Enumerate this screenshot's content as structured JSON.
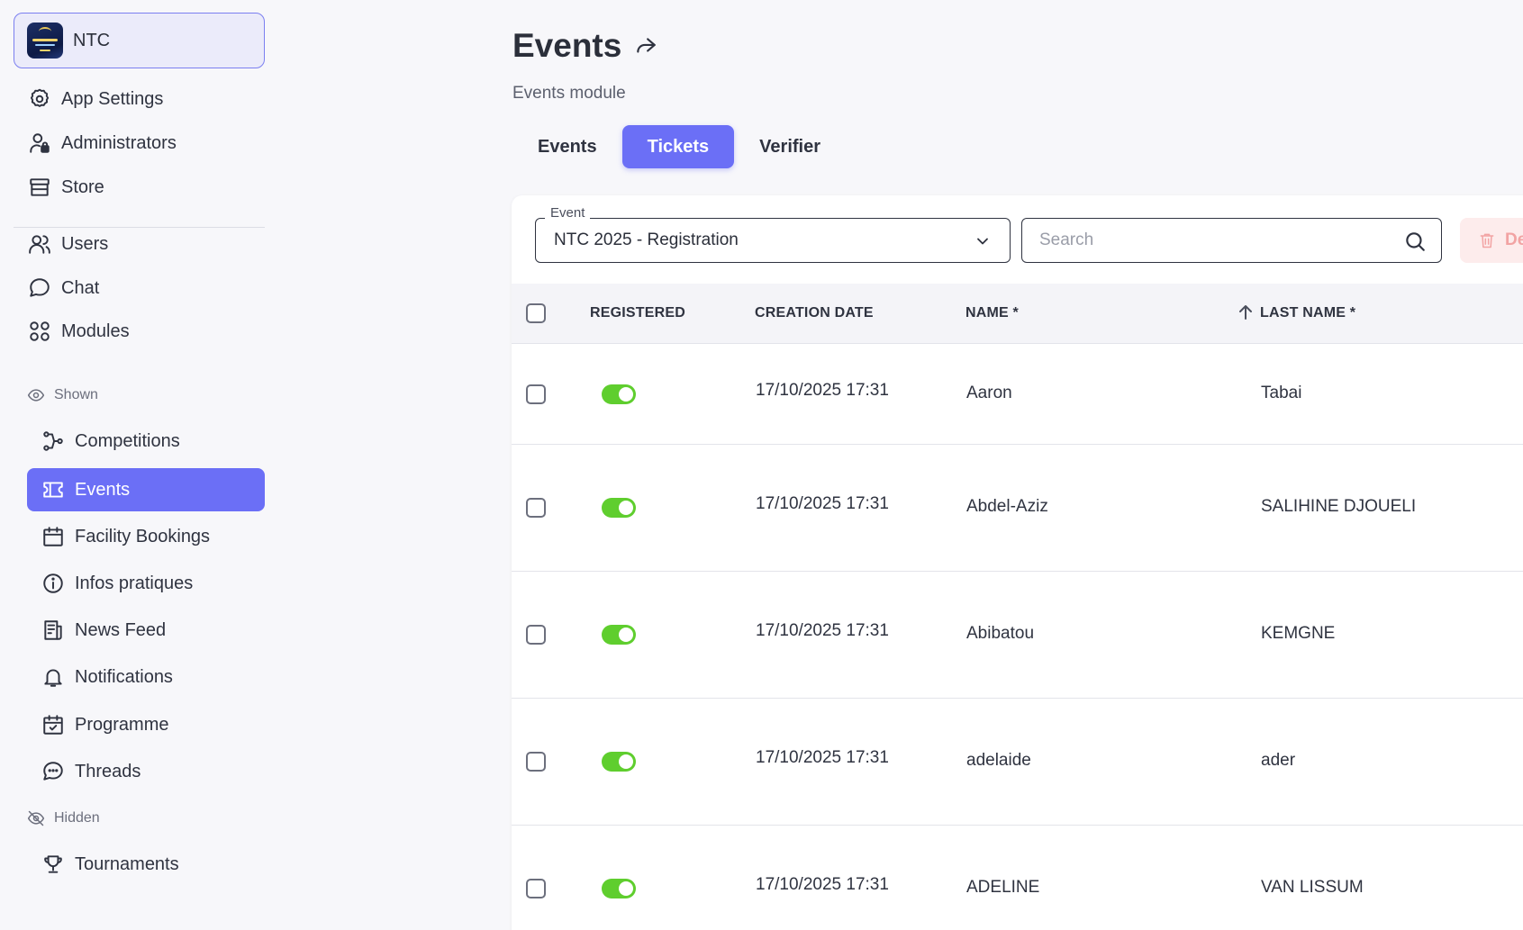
{
  "app": {
    "name": "NTC"
  },
  "sidebar": {
    "top_items": [
      {
        "label": "App Settings",
        "icon": "gear-icon"
      },
      {
        "label": "Administrators",
        "icon": "user-lock-icon"
      },
      {
        "label": "Store",
        "icon": "store-icon"
      }
    ],
    "main_items": [
      {
        "label": "Users",
        "icon": "users-icon"
      },
      {
        "label": "Chat",
        "icon": "chat-icon"
      },
      {
        "label": "Modules",
        "icon": "modules-icon"
      }
    ],
    "shown_label": "Shown",
    "shown_items": [
      {
        "label": "Competitions",
        "icon": "branch-icon"
      },
      {
        "label": "Events",
        "icon": "ticket-icon",
        "active": true
      },
      {
        "label": "Facility Bookings",
        "icon": "calendar-icon"
      },
      {
        "label": "Infos pratiques",
        "icon": "info-icon"
      },
      {
        "label": "News Feed",
        "icon": "newspaper-icon"
      },
      {
        "label": "Notifications",
        "icon": "bell-icon"
      },
      {
        "label": "Programme",
        "icon": "calendar-check-icon"
      },
      {
        "label": "Threads",
        "icon": "chat-dots-icon"
      }
    ],
    "hidden_label": "Hidden",
    "hidden_items": [
      {
        "label": "Tournaments",
        "icon": "trophy-icon"
      }
    ]
  },
  "header": {
    "title": "Events",
    "subtitle": "Events module",
    "tabs": [
      {
        "label": "Events",
        "active": false
      },
      {
        "label": "Tickets",
        "active": true
      },
      {
        "label": "Verifier",
        "active": false
      }
    ]
  },
  "filters": {
    "event_label": "Event",
    "event_value": "NTC 2025 - Registration",
    "search_placeholder": "Search",
    "delete_label": "Delete"
  },
  "table": {
    "columns": [
      "REGISTERED",
      "CREATION DATE",
      "NAME *",
      "LAST NAME *"
    ],
    "rows": [
      {
        "registered": true,
        "creation_date": "17/10/2025 17:31",
        "name": "Aaron",
        "last_name": "Tabai"
      },
      {
        "registered": true,
        "creation_date": "17/10/2025 17:31",
        "name": "Abdel-Aziz",
        "last_name": "SALIHINE DJOUELI"
      },
      {
        "registered": true,
        "creation_date": "17/10/2025 17:31",
        "name": "Abibatou",
        "last_name": "KEMGNE"
      },
      {
        "registered": true,
        "creation_date": "17/10/2025 17:31",
        "name": "adelaide",
        "last_name": "ader"
      },
      {
        "registered": true,
        "creation_date": "17/10/2025 17:31",
        "name": "ADELINE",
        "last_name": "VAN LISSUM"
      }
    ]
  },
  "colors": {
    "accent": "#6b6ff6",
    "toggle_on": "#5fce2e",
    "danger_soft": "#fdecec"
  }
}
